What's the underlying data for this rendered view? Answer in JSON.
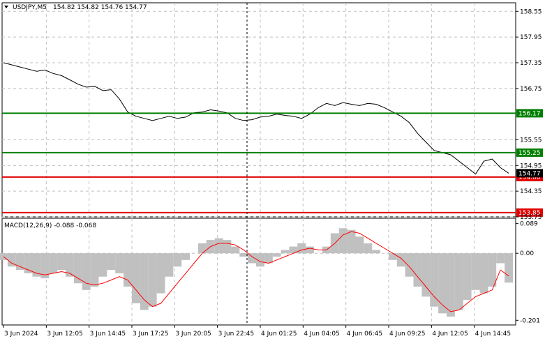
{
  "chart_header": {
    "symbol": "USDJPY,M5",
    "ohlc": "154.82 154.82 154.76 154.77",
    "dropdown_icon": "triangle-down-icon"
  },
  "indicator_header": {
    "text": "MACD(12,26,9) -0.088 -0.068"
  },
  "colors": {
    "green_level": "#008000",
    "red_level": "#e00000",
    "price_line": "#000000",
    "macd_histogram": "#c0c0c0",
    "macd_signal": "#ff0000",
    "grid": "#c0c0c0"
  },
  "chart_data": [
    {
      "type": "line",
      "title": "USDJPY,M5",
      "y_ticks": [
        "158.55",
        "157.95",
        "157.35",
        "156.75",
        "155.55",
        "154.95",
        "154.35",
        "153.75"
      ],
      "ylim": [
        153.75,
        158.75
      ],
      "levels": [
        {
          "value": 156.17,
          "label": "156.17",
          "color": "#008000"
        },
        {
          "value": 155.25,
          "label": "155.25",
          "color": "#008000"
        },
        {
          "value": 154.68,
          "label": "154.68",
          "color": "#e00000"
        },
        {
          "value": 153.85,
          "label": "153.85",
          "color": "#e00000"
        }
      ],
      "current_price_label": "154.77",
      "x_ticks": [
        "3 Jun 2024",
        "3 Jun 12:05",
        "3 Jun 14:45",
        "3 Jun 17:25",
        "3 Jun 20:05",
        "3 Jun 22:45",
        "4 Jun 01:25",
        "4 Jun 04:05",
        "4 Jun 06:45",
        "4 Jun 09:25",
        "4 Jun 12:05",
        "4 Jun 14:45"
      ],
      "series": [
        {
          "values": [
            157.35,
            157.3,
            157.25,
            157.2,
            157.15,
            157.18,
            157.1,
            157.05,
            156.95,
            156.85,
            156.78,
            156.8,
            156.7,
            156.72,
            156.5,
            156.2,
            156.1,
            156.05,
            156.0,
            156.05,
            156.1,
            156.05,
            156.08,
            156.18,
            156.2,
            156.25,
            156.22,
            156.18,
            156.05,
            156.0,
            156.02,
            156.08,
            156.1,
            156.15,
            156.12,
            156.1,
            156.05,
            156.15,
            156.3,
            156.4,
            156.35,
            156.42,
            156.38,
            156.35,
            156.4,
            156.38,
            156.3,
            156.2,
            156.1,
            155.95,
            155.7,
            155.5,
            155.3,
            155.25,
            155.2,
            155.05,
            154.9,
            154.75,
            155.05,
            155.1,
            154.9,
            154.77
          ]
        }
      ]
    },
    {
      "type": "bar",
      "title": "MACD(12,26,9)",
      "y_ticks": [
        "0.089",
        "0.00",
        "-0.201"
      ],
      "ylim": [
        -0.201,
        0.089
      ],
      "series": [
        {
          "name": "main",
          "values": [
            -0.02,
            -0.04,
            -0.05,
            -0.06,
            -0.07,
            -0.075,
            -0.06,
            -0.05,
            -0.07,
            -0.09,
            -0.11,
            -0.1,
            -0.07,
            -0.05,
            -0.06,
            -0.1,
            -0.15,
            -0.17,
            -0.16,
            -0.12,
            -0.07,
            -0.04,
            -0.02,
            0.0,
            0.03,
            0.04,
            0.045,
            0.04,
            0.02,
            -0.01,
            -0.03,
            -0.04,
            -0.03,
            -0.01,
            0.01,
            0.02,
            0.03,
            0.02,
            0.0,
            0.02,
            0.06,
            0.075,
            0.07,
            0.05,
            0.03,
            0.01,
            0.0,
            -0.02,
            -0.04,
            -0.07,
            -0.1,
            -0.13,
            -0.16,
            -0.18,
            -0.19,
            -0.17,
            -0.14,
            -0.11,
            -0.12,
            -0.1,
            -0.03,
            -0.088
          ]
        },
        {
          "name": "signal",
          "values": [
            -0.01,
            -0.03,
            -0.04,
            -0.05,
            -0.06,
            -0.065,
            -0.06,
            -0.055,
            -0.06,
            -0.075,
            -0.09,
            -0.095,
            -0.09,
            -0.08,
            -0.07,
            -0.08,
            -0.11,
            -0.14,
            -0.16,
            -0.15,
            -0.12,
            -0.09,
            -0.06,
            -0.03,
            0.0,
            0.02,
            0.03,
            0.03,
            0.025,
            0.01,
            -0.01,
            -0.025,
            -0.03,
            -0.02,
            -0.01,
            0.0,
            0.01,
            0.015,
            0.01,
            0.01,
            0.03,
            0.055,
            0.065,
            0.06,
            0.045,
            0.03,
            0.015,
            0.0,
            -0.015,
            -0.04,
            -0.07,
            -0.1,
            -0.13,
            -0.155,
            -0.175,
            -0.17,
            -0.15,
            -0.13,
            -0.12,
            -0.11,
            -0.05,
            -0.068
          ]
        }
      ]
    }
  ]
}
